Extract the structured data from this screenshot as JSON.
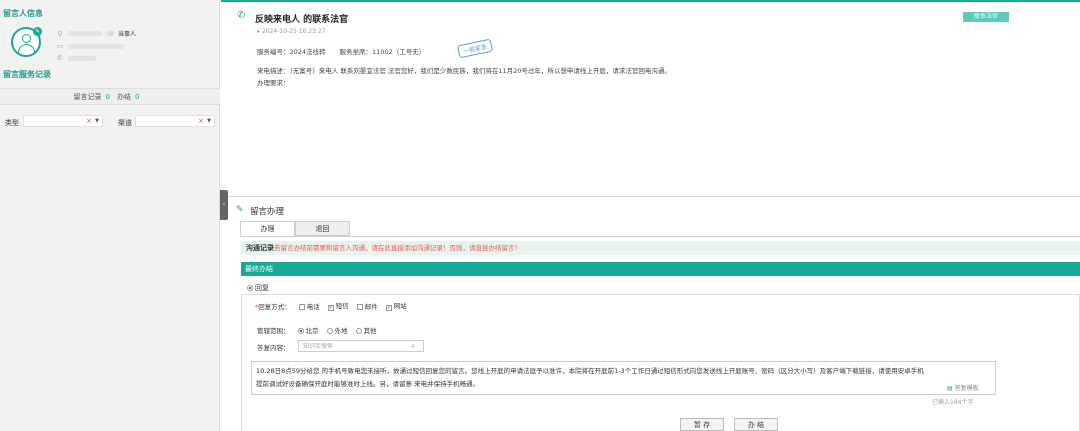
{
  "left": {
    "section1_title": "留言人信息",
    "party_label": "当事人",
    "section2_title": "留言服务记录",
    "stats": {
      "records_label": "留言记录",
      "records_count": "0",
      "handled_label": "办结",
      "handled_count": "0"
    },
    "filters": {
      "type_label": "类型",
      "channel_label": "渠道",
      "clear_symbol": "×"
    }
  },
  "header": {
    "title": "反映来电人          的联系法官",
    "contact_button": "联系法官",
    "timestamp": "2024-10-25 16:23:27",
    "service_no": "服务编号：2024法线转",
    "service_seat": "服务坐席：11002（工号无）",
    "stamp": "一般紧急",
    "description": "来电描述：（无案号）来电人       联系刘晏宜法官 法官您好，我们是少数民族，我们将在11月20号过年，所以想申请线上开庭，请求法官回电沟通。",
    "requirement": "办理要求："
  },
  "panel": {
    "title": "留言办理",
    "tabs": [
      "办理",
      "退回"
    ],
    "notice_title": "沟通记录",
    "notice_text": "若留言办结前需要和留言人沟通，请在此直接添加沟通记录！否则，请直接办结留言！",
    "final_title": "最终办结",
    "reply_option": "回复",
    "reply_method_label": "回复方式：",
    "methods": [
      "电话",
      "短信",
      "邮件",
      "网站"
    ],
    "jurisdiction_label": "管辖范围：",
    "jurisdictions": [
      "北京",
      "外地",
      "其他"
    ],
    "answer_label": "答复内容：",
    "search_placeholder": "知识库搜索",
    "content_line1": "10.28日8点59分给您                的手机号致电您未接听，故通过短信回复您的留言。您线上开庭的申请法庭予以准许，本院将在开庭前1-3个工作日通过短信形式向您发送线上开庭账号、密码（区分大小写）及客户端下载链接，请使用安卓手机",
    "content_line2": "提前调试好设备确保开庭时能够准时上线。另，请留意                来电并保持手机畅通。",
    "template_link": "答复模板",
    "counter": "已输入164个字",
    "save_button": "暂 存",
    "finish_button": "办 结"
  },
  "colors": {
    "accent": "#1aa898",
    "notice_bg": "#e6f4ee",
    "warning": "#e55555"
  }
}
